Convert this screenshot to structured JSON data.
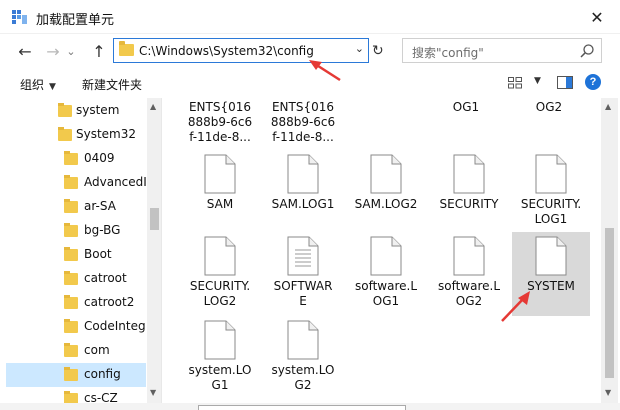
{
  "window": {
    "title": "加载配置单元",
    "close_glyph": "✕"
  },
  "nav": {
    "back_glyph": "←",
    "forward_glyph": "→",
    "history_glyph": "⌄",
    "up_glyph": "↑",
    "address": "C:\\Windows\\System32\\config",
    "address_dropdown_glyph": "⌄",
    "refresh_glyph": "↻",
    "search_placeholder": "搜索\"config\""
  },
  "toolbar": {
    "organize_label": "组织",
    "caret": "▼",
    "new_folder_label": "新建文件夹",
    "help_glyph": "?"
  },
  "tree": {
    "items": [
      {
        "label": "system",
        "indent": 1
      },
      {
        "label": "System32",
        "indent": 1
      },
      {
        "label": "0409",
        "indent": 2
      },
      {
        "label": "AdvancedI",
        "indent": 2
      },
      {
        "label": "ar-SA",
        "indent": 2
      },
      {
        "label": "bg-BG",
        "indent": 2
      },
      {
        "label": "Boot",
        "indent": 2
      },
      {
        "label": "catroot",
        "indent": 2
      },
      {
        "label": "catroot2",
        "indent": 2
      },
      {
        "label": "CodeInteg",
        "indent": 2
      },
      {
        "label": "com",
        "indent": 2
      },
      {
        "label": "config",
        "indent": 2,
        "selected": true
      },
      {
        "label": "cs-CZ",
        "indent": 2
      }
    ],
    "scroll_up_glyph": "▲",
    "scroll_down_glyph": "▼"
  },
  "files": {
    "top_row_partial": [
      "ENTS{016\n888b9-6c6\nf-11de-8...",
      "ENTS{016\n888b9-6c6\nf-11de-8...",
      "OG1",
      "OG2"
    ],
    "items": [
      {
        "name": "SAM"
      },
      {
        "name": "SAM.LOG1"
      },
      {
        "name": "SAM.LOG2"
      },
      {
        "name": "SECURITY"
      },
      {
        "name": "SECURITY.\nLOG1"
      },
      {
        "name": "SECURITY.\nLOG2"
      },
      {
        "name": "SOFTWAR\nE",
        "has_lines": true
      },
      {
        "name": "software.L\nOG1"
      },
      {
        "name": "software.L\nOG2"
      },
      {
        "name": "SYSTEM",
        "selected": true
      },
      {
        "name": "system.LO\nG1"
      },
      {
        "name": "system.LO\nG2"
      }
    ]
  },
  "colors": {
    "accent": "#2b79d8",
    "selection": "#cce8ff",
    "file_selected": "#d9d9d9",
    "folder": "#f2c94c",
    "annotation_arrow": "#e53935"
  }
}
